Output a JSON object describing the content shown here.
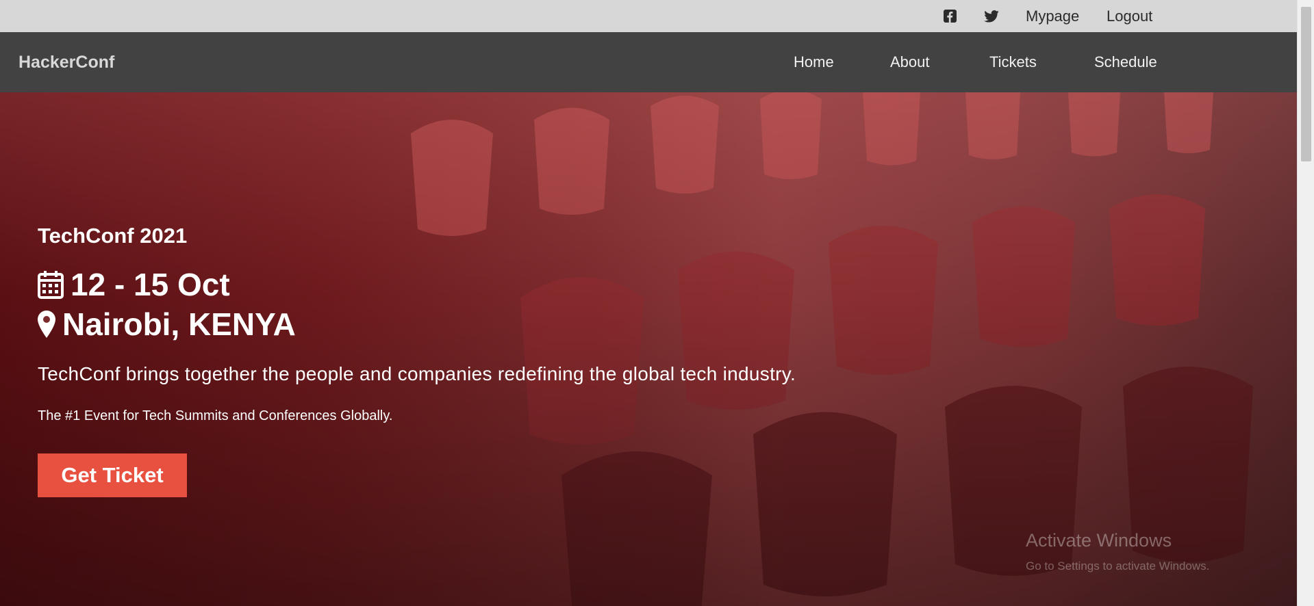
{
  "topbar": {
    "facebook_icon": "facebook-square-icon",
    "twitter_icon": "twitter-icon",
    "mypage_label": "Mypage",
    "logout_label": "Logout"
  },
  "navbar": {
    "brand": "HackerConf",
    "links": [
      "Home",
      "About",
      "Tickets",
      "Schedule"
    ]
  },
  "hero": {
    "title": "TechConf 2021",
    "date": "12 - 15 Oct",
    "date_icon": "calendar-icon",
    "location": "Nairobi, KENYA",
    "location_icon": "map-marker-icon",
    "tagline": "TechConf brings together the people and companies redefining the global tech industry.",
    "subtitle": "The #1 Event for Tech Summits and Conferences Globally.",
    "cta_label": "Get Ticket"
  },
  "system": {
    "activate_title": "Activate Windows",
    "activate_sub": "Go to Settings to activate Windows."
  },
  "colors": {
    "accent": "#e8503f",
    "navbar": "#424242",
    "topbar": "#d7d7d7"
  }
}
